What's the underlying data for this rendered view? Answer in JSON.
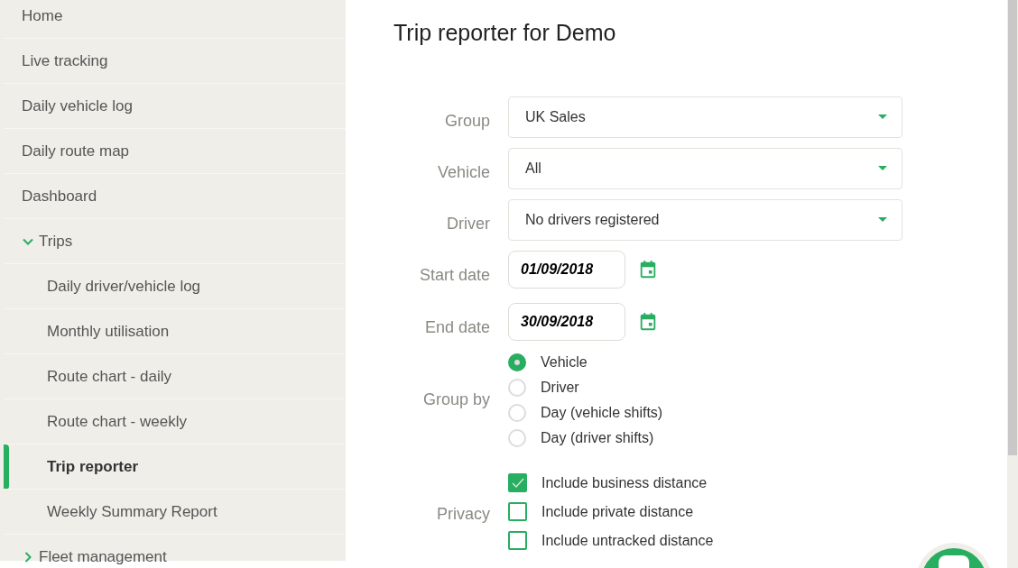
{
  "sidebar": {
    "items": [
      {
        "label": "Home",
        "selected": false
      },
      {
        "label": "Live tracking",
        "selected": false
      },
      {
        "label": "Daily vehicle log",
        "selected": false
      },
      {
        "label": "Daily route map",
        "selected": false
      },
      {
        "label": "Dashboard",
        "selected": false
      },
      {
        "label": "Trips",
        "selected": false,
        "expanded": true,
        "children": [
          {
            "label": "Daily driver/vehicle log",
            "selected": false
          },
          {
            "label": "Monthly utilisation",
            "selected": false
          },
          {
            "label": "Route chart - daily",
            "selected": false
          },
          {
            "label": "Route chart - weekly",
            "selected": false
          },
          {
            "label": "Trip reporter",
            "selected": true
          },
          {
            "label": "Weekly Summary Report",
            "selected": false
          }
        ]
      },
      {
        "label": "Fleet management",
        "selected": false,
        "expanded": false
      }
    ]
  },
  "page": {
    "title": "Trip reporter for Demo"
  },
  "form": {
    "selects": [
      {
        "label": "Group",
        "value": "UK Sales"
      },
      {
        "label": "Vehicle",
        "value": "All"
      },
      {
        "label": "Driver",
        "value": "No drivers registered"
      }
    ],
    "dates": [
      {
        "label": "Start date",
        "value": "01/09/2018"
      },
      {
        "label": "End date",
        "value": "30/09/2018"
      }
    ],
    "group_by": {
      "label": "Group by",
      "options": [
        {
          "label": "Vehicle",
          "selected": true
        },
        {
          "label": "Driver",
          "selected": false
        },
        {
          "label": "Day (vehicle shifts)",
          "selected": false
        },
        {
          "label": "Day (driver shifts)",
          "selected": false
        }
      ]
    },
    "privacy": {
      "label": "Privacy",
      "options": [
        {
          "label": "Include business distance",
          "checked": true
        },
        {
          "label": "Include private distance",
          "checked": false
        },
        {
          "label": "Include untracked distance",
          "checked": false
        }
      ]
    }
  }
}
